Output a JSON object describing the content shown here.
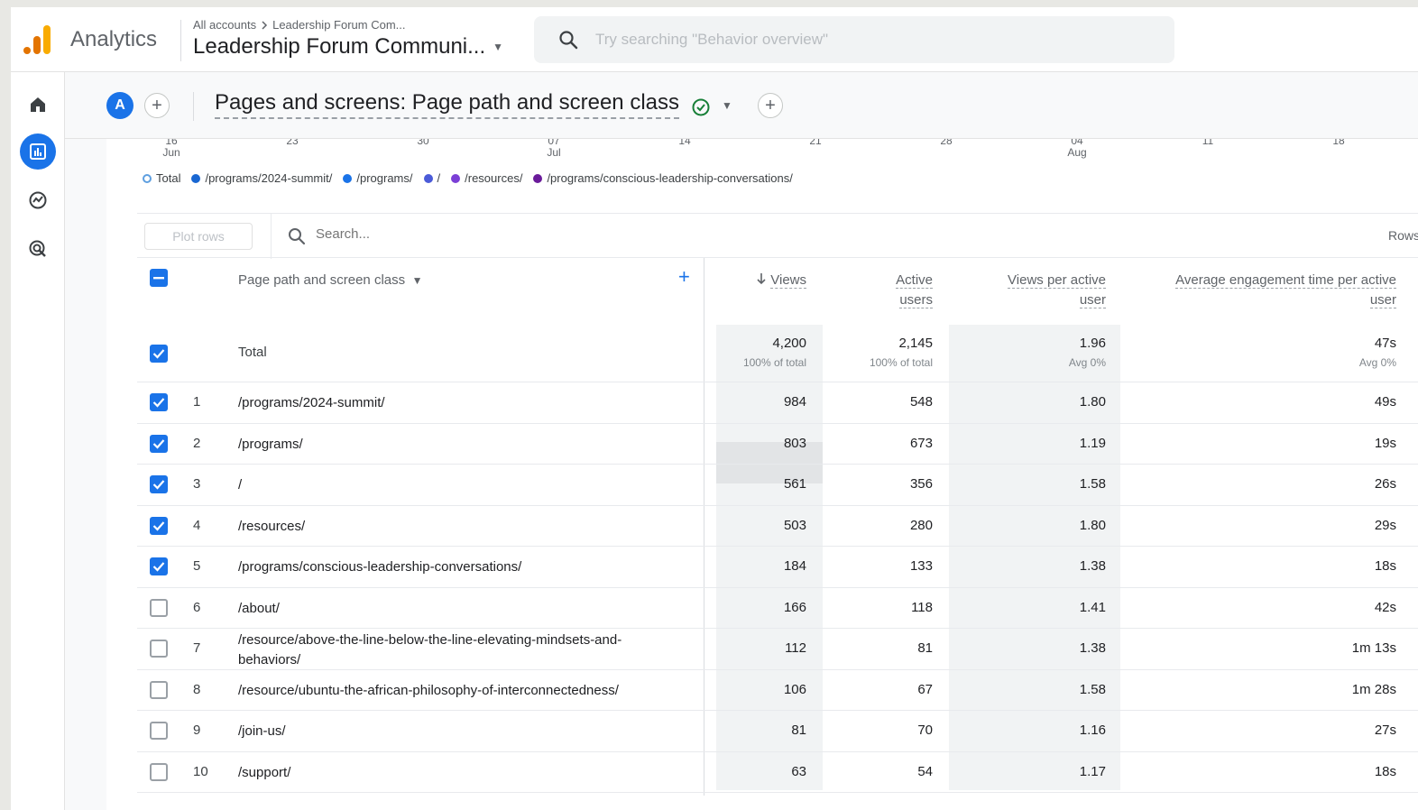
{
  "topbar": {
    "app_name": "Analytics",
    "breadcrumb_root": "All accounts",
    "breadcrumb_account": "Leadership Forum Com...",
    "property_name": "Leadership Forum Communi...",
    "search_placeholder": "Try searching \"Behavior overview\""
  },
  "sidenav": {
    "items": [
      {
        "icon": "home-icon"
      },
      {
        "icon": "reports-icon",
        "active": true
      },
      {
        "icon": "explore-icon"
      },
      {
        "icon": "advertising-icon"
      }
    ]
  },
  "titlebar": {
    "avatar_letter": "A",
    "report_title": "Pages and screens: Page path and screen class"
  },
  "chart_axis": [
    {
      "day": "16",
      "month": "Jun"
    },
    {
      "day": "23",
      "month": ""
    },
    {
      "day": "30",
      "month": ""
    },
    {
      "day": "07",
      "month": "Jul"
    },
    {
      "day": "14",
      "month": ""
    },
    {
      "day": "21",
      "month": ""
    },
    {
      "day": "28",
      "month": ""
    },
    {
      "day": "04",
      "month": "Aug"
    },
    {
      "day": "11",
      "month": ""
    },
    {
      "day": "18",
      "month": ""
    }
  ],
  "legend": [
    {
      "label": "Total",
      "color": "#5e9fe0",
      "hollow": true
    },
    {
      "label": "/programs/2024-summit/",
      "color": "#1967d2"
    },
    {
      "label": "/programs/",
      "color": "#1a73e8"
    },
    {
      "label": "/",
      "color": "#4b5bd8"
    },
    {
      "label": "/resources/",
      "color": "#7b3fd6"
    },
    {
      "label": "/programs/conscious-leadership-conversations/",
      "color": "#6a1b9a"
    }
  ],
  "toolbar": {
    "plot_rows_label": "Plot rows",
    "search_placeholder": "Search...",
    "rows_label": "Rows"
  },
  "table": {
    "dimension_header": "Page path and screen class",
    "headers": {
      "views": "Views",
      "active_users_1": "Active",
      "active_users_2": "users",
      "vpau_1": "Views per active",
      "vpau_2": "user",
      "aet_1": "Average engagement time per active",
      "aet_2": "user"
    },
    "total": {
      "label": "Total",
      "views": "4,200",
      "views_sub": "100% of total",
      "active_users": "2,145",
      "active_users_sub": "100% of total",
      "vpau": "1.96",
      "vpau_sub": "Avg 0%",
      "aet": "47s",
      "aet_sub": "Avg 0%"
    },
    "rows": [
      {
        "rank": "1",
        "path": "/programs/2024-summit/",
        "views": "984",
        "users": "548",
        "vpau": "1.80",
        "aet": "49s",
        "checked": true
      },
      {
        "rank": "2",
        "path": "/programs/",
        "views": "803",
        "users": "673",
        "vpau": "1.19",
        "aet": "19s",
        "checked": true
      },
      {
        "rank": "3",
        "path": "/",
        "views": "561",
        "users": "356",
        "vpau": "1.58",
        "aet": "26s",
        "checked": true
      },
      {
        "rank": "4",
        "path": "/resources/",
        "views": "503",
        "users": "280",
        "vpau": "1.80",
        "aet": "29s",
        "checked": true
      },
      {
        "rank": "5",
        "path": "/programs/conscious-leadership-conversations/",
        "views": "184",
        "users": "133",
        "vpau": "1.38",
        "aet": "18s",
        "checked": true
      },
      {
        "rank": "6",
        "path": "/about/",
        "views": "166",
        "users": "118",
        "vpau": "1.41",
        "aet": "42s",
        "checked": false
      },
      {
        "rank": "7",
        "path": "/resource/above-the-line-below-the-line-elevating-mindsets-and-",
        "path2": "behaviors/",
        "views": "112",
        "users": "81",
        "vpau": "1.38",
        "aet": "1m 13s",
        "checked": false
      },
      {
        "rank": "8",
        "path": "/resource/ubuntu-the-african-philosophy-of-interconnectedness/",
        "views": "106",
        "users": "67",
        "vpau": "1.58",
        "aet": "1m 28s",
        "checked": false
      },
      {
        "rank": "9",
        "path": "/join-us/",
        "views": "81",
        "users": "70",
        "vpau": "1.16",
        "aet": "27s",
        "checked": false
      },
      {
        "rank": "10",
        "path": "/support/",
        "views": "63",
        "users": "54",
        "vpau": "1.17",
        "aet": "18s",
        "checked": false
      }
    ]
  }
}
